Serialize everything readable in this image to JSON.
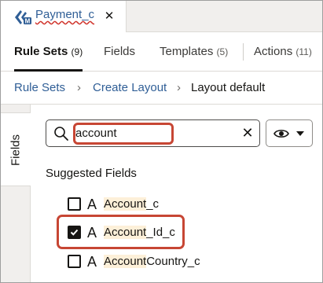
{
  "colors": {
    "link": "#2f5e96",
    "highlight_outline": "#c74634",
    "match_highlight": "#fdf0d9"
  },
  "doc_tab": {
    "icon": "custom-object-icon",
    "label": "Payment_c",
    "close_icon": "close-icon"
  },
  "nav_tabs": [
    {
      "label": "Rule Sets",
      "count": "(9)",
      "active": true
    },
    {
      "label": "Fields",
      "count": "",
      "active": false
    },
    {
      "label": "Templates",
      "count": "(5)",
      "active": false
    },
    {
      "label": "Actions",
      "count": "(11)",
      "active": false
    }
  ],
  "breadcrumb": {
    "items": [
      "Rule Sets",
      "Create Layout"
    ],
    "current": "Layout default",
    "separator": "›"
  },
  "side_panel": {
    "tab_label": "Fields"
  },
  "search": {
    "value": "account",
    "icon": "search-icon",
    "clear_icon": "clear-icon"
  },
  "view_menu": {
    "icon": "eye-icon",
    "caret": "chevron-down-icon"
  },
  "suggested": {
    "title": "Suggested Fields",
    "type_icon_glyph": "A",
    "items": [
      {
        "match": "Account",
        "rest": "_c",
        "checked": false
      },
      {
        "match": "Account",
        "rest": "_Id_c",
        "checked": true
      },
      {
        "match": "Account",
        "rest": "Country_c",
        "checked": false
      }
    ]
  }
}
